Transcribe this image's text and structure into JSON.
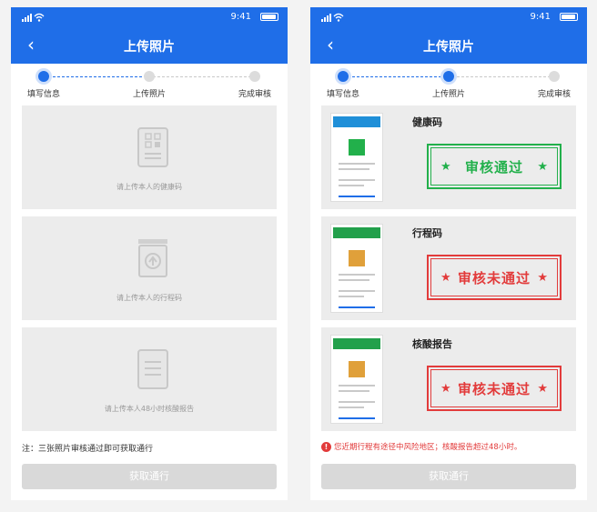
{
  "screens": [
    {
      "status": {
        "time": "9:41"
      },
      "nav": {
        "back": "‹",
        "title": "上传照片"
      },
      "steps": [
        "填写信息",
        "上传照片",
        "完成审核"
      ],
      "uploads": [
        {
          "text": "请上传本人的健康码",
          "icon": "qr-doc-icon"
        },
        {
          "text": "请上传本人的行程码",
          "icon": "upload-box-icon"
        },
        {
          "text": "请上传本人48小时核酸报告",
          "icon": "report-doc-icon"
        }
      ],
      "note": "注：三张照片审核通过即可获取通行",
      "button": "获取通行"
    },
    {
      "status": {
        "time": "9:41"
      },
      "nav": {
        "back": "‹",
        "title": "上传照片"
      },
      "steps": [
        "填写信息",
        "上传照片",
        "完成审核"
      ],
      "results": [
        {
          "title": "健康码",
          "stamp": "审核通过",
          "star": "★",
          "color": "#22b04b"
        },
        {
          "title": "行程码",
          "stamp": "审核未通过",
          "star": "★",
          "color": "#e23b3b"
        },
        {
          "title": "核酸报告",
          "stamp": "审核未通过",
          "star": "★",
          "color": "#e23b3b"
        }
      ],
      "warning": {
        "icon": "!",
        "text": "您近期行程有途径中风险地区；核酸报告超过48小时。"
      },
      "button": "获取通行"
    }
  ]
}
